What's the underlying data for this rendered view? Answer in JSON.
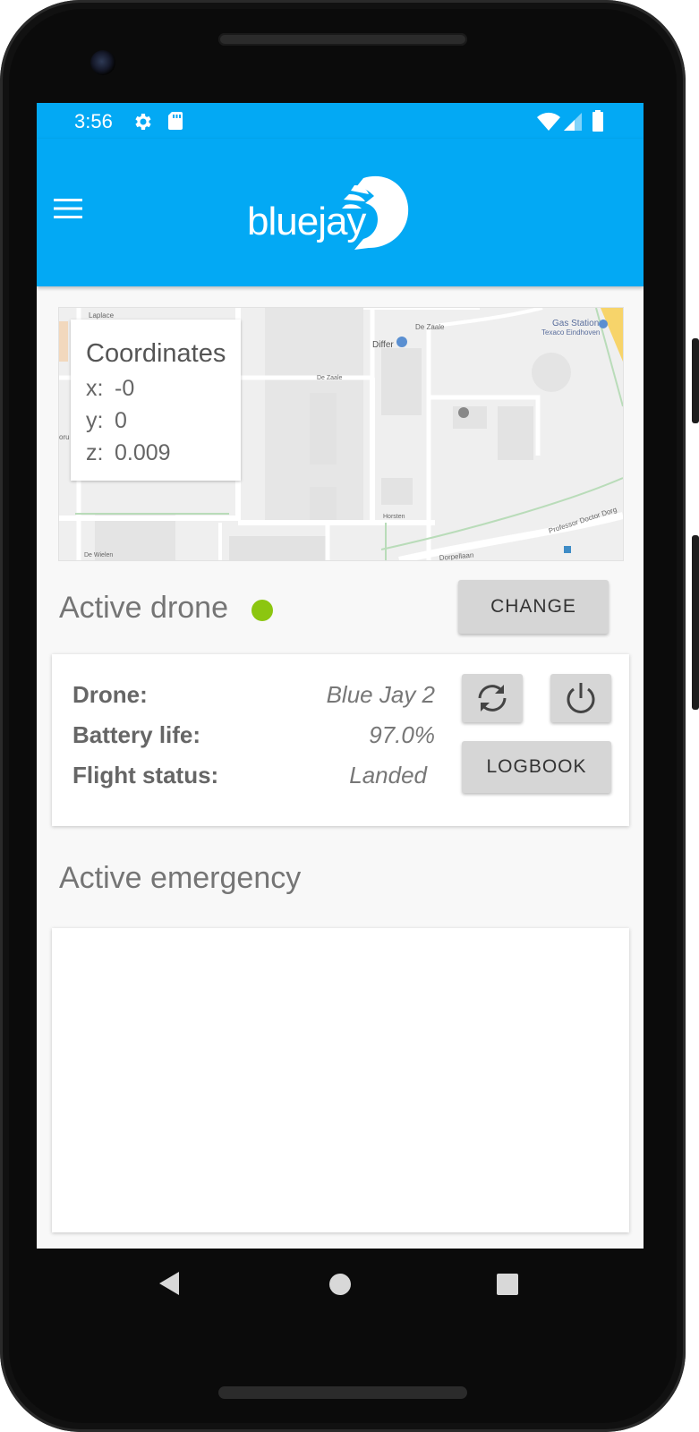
{
  "status_bar": {
    "time": "3:56",
    "icons": [
      "gear-icon",
      "sd-card-icon",
      "wifi-icon",
      "signal-icon",
      "battery-icon"
    ]
  },
  "app_bar": {
    "menu_icon": "hamburger-menu-icon",
    "logo_text": "bluejay"
  },
  "map": {
    "street_labels": [
      "Laplace",
      "De Zaale",
      "Differ",
      "De Zaale",
      "Gas Station",
      "Texaco Eindhoven",
      "Horsten",
      "De Rondom",
      "Horsten",
      "Professor Doctor Dorg",
      "Dorpellaan",
      "De Wielen",
      "De Wielen",
      "oru"
    ]
  },
  "coordinates": {
    "title": "Coordinates",
    "x_label": "x:",
    "x_value": "-0",
    "y_label": "y:",
    "y_value": "0",
    "z_label": "z:",
    "z_value": "0.009"
  },
  "active_drone": {
    "title": "Active drone",
    "status_color": "#8cc610",
    "change_button": "CHANGE"
  },
  "drone_info": {
    "drone_label": "Drone:",
    "drone_value": "Blue Jay 2",
    "battery_label": "Battery life:",
    "battery_value": "97.0%",
    "flight_label": "Flight status:",
    "flight_value": "Landed",
    "refresh_icon": "refresh-icon",
    "power_icon": "power-icon",
    "logbook_button": "LOGBOOK"
  },
  "emergency": {
    "title": "Active emergency"
  },
  "nav_bar": {
    "icons": [
      "back-icon",
      "home-icon",
      "recents-icon"
    ]
  },
  "colors": {
    "primary": "#03a9f4",
    "background": "#f8f8f8",
    "button": "#d6d6d6"
  }
}
